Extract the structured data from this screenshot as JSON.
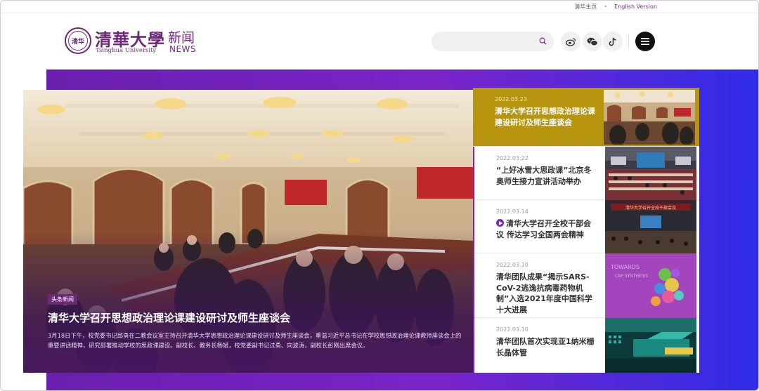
{
  "top_links": {
    "home": "清华主页",
    "english": "English Version"
  },
  "logo": {
    "cn": "清華大學",
    "en": "Tsinghua University",
    "news_cn": "新闻",
    "news_en": "NEWS",
    "seal": "清华"
  },
  "search": {
    "placeholder": ""
  },
  "social": [
    "weibo-icon",
    "wechat-icon",
    "douyin-icon"
  ],
  "hero": {
    "tag": "头条新闻",
    "title": "清华大学召开思想政治理论课建设研讨及师生座谈会",
    "desc": "3月18日下午，校党委书记邱勇在二教会议室主持召开清华大学思想政治理论课建设研讨及师生座谈会，重温习近平总书记在学校思想政治理论课教师座谈会上的重要讲话精神，研究部署推动学校的思政课建设。副校长、教务长杨斌，校党委副书记过勇、向波涛，副校长彭刚出席会议。"
  },
  "news": [
    {
      "date": "2022.03.23",
      "title": "清华大学召开思想政治理论课建设研讨及师生座谈会",
      "video": false
    },
    {
      "date": "2022.03.22",
      "title": "“上好冰雪大思政课”北京冬奥师生接力宣讲活动举办",
      "video": false
    },
    {
      "date": "2022.03.14",
      "title": "清华大学召开全校干部会议 传达学习全国两会精神",
      "video": true
    },
    {
      "date": "2022.03.10",
      "title": "清华团队成果“揭示SARS-CoV-2逃逸抗病毒药物机制”入选2021年度中国科学十大进展",
      "video": false
    },
    {
      "date": "2022.03.10",
      "title": "清华团队首次实现亚1纳米栅长晶体管",
      "video": false
    }
  ],
  "thumb_text": {
    "slide": "清华大学召开全校干部会议",
    "sars_1": "TOWARDS",
    "sars_2": "CAP SYNTHESIS"
  },
  "colors": {
    "brand": "#6d2877",
    "active": "#b8950e",
    "band_start": "#6a1fae",
    "band_end": "#2f2ce8"
  }
}
